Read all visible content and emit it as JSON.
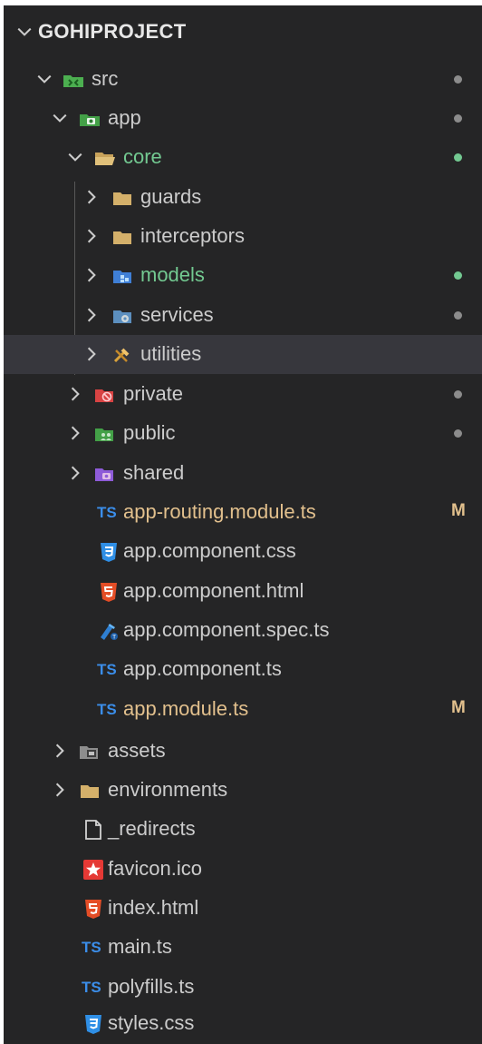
{
  "explorer": {
    "project_title": "GOHIPROJECT",
    "colors": {
      "modified": "#e2c08d",
      "untracked": "#73c991",
      "dot_grey": "#8c8c8c",
      "default_text": "#cccccc",
      "selected_row": "#37373d"
    },
    "rows": [
      {
        "label": "src",
        "kind": "folder",
        "icon": "src-folder-icon",
        "expanded": true,
        "status": "dot-grey"
      },
      {
        "label": "app",
        "kind": "folder",
        "icon": "app-folder-icon",
        "expanded": true,
        "status": "dot-grey"
      },
      {
        "label": "core",
        "kind": "folder",
        "icon": "open-folder-icon",
        "expanded": true,
        "status": "dot-green"
      },
      {
        "label": "guards",
        "kind": "folder",
        "icon": "folder-icon",
        "expanded": false
      },
      {
        "label": "interceptors",
        "kind": "folder",
        "icon": "folder-icon",
        "expanded": false
      },
      {
        "label": "models",
        "kind": "folder",
        "icon": "models-folder-icon",
        "expanded": false,
        "status": "dot-green"
      },
      {
        "label": "services",
        "kind": "folder",
        "icon": "services-folder-icon",
        "expanded": false,
        "status": "dot-grey"
      },
      {
        "label": "utilities",
        "kind": "folder",
        "icon": "utilities-folder-icon",
        "expanded": false,
        "selected": true
      },
      {
        "label": "private",
        "kind": "folder",
        "icon": "private-folder-icon",
        "expanded": false,
        "status": "dot-grey"
      },
      {
        "label": "public",
        "kind": "folder",
        "icon": "public-folder-icon",
        "expanded": false,
        "status": "dot-grey"
      },
      {
        "label": "shared",
        "kind": "folder",
        "icon": "shared-folder-icon",
        "expanded": false
      },
      {
        "label": "app-routing.module.ts",
        "kind": "file",
        "icon": "typescript-icon",
        "status": "M"
      },
      {
        "label": "app.component.css",
        "kind": "file",
        "icon": "css-icon"
      },
      {
        "label": "app.component.html",
        "kind": "file",
        "icon": "html-icon"
      },
      {
        "label": "app.component.spec.ts",
        "kind": "file",
        "icon": "spec-test-icon"
      },
      {
        "label": "app.component.ts",
        "kind": "file",
        "icon": "typescript-icon"
      },
      {
        "label": "app.module.ts",
        "kind": "file",
        "icon": "typescript-icon",
        "status": "M"
      },
      {
        "label": "assets",
        "kind": "folder",
        "icon": "assets-folder-icon",
        "expanded": false
      },
      {
        "label": "environments",
        "kind": "folder",
        "icon": "folder-icon",
        "expanded": false
      },
      {
        "label": "_redirects",
        "kind": "file",
        "icon": "blank-file-icon"
      },
      {
        "label": "favicon.ico",
        "kind": "file",
        "icon": "favicon-star-icon"
      },
      {
        "label": "index.html",
        "kind": "file",
        "icon": "html-icon"
      },
      {
        "label": "main.ts",
        "kind": "file",
        "icon": "typescript-icon"
      },
      {
        "label": "polyfills.ts",
        "kind": "file",
        "icon": "typescript-icon"
      },
      {
        "label": "styles.css",
        "kind": "file",
        "icon": "css-icon"
      }
    ],
    "badge_modified": "M",
    "ts_glyph": "TS"
  }
}
